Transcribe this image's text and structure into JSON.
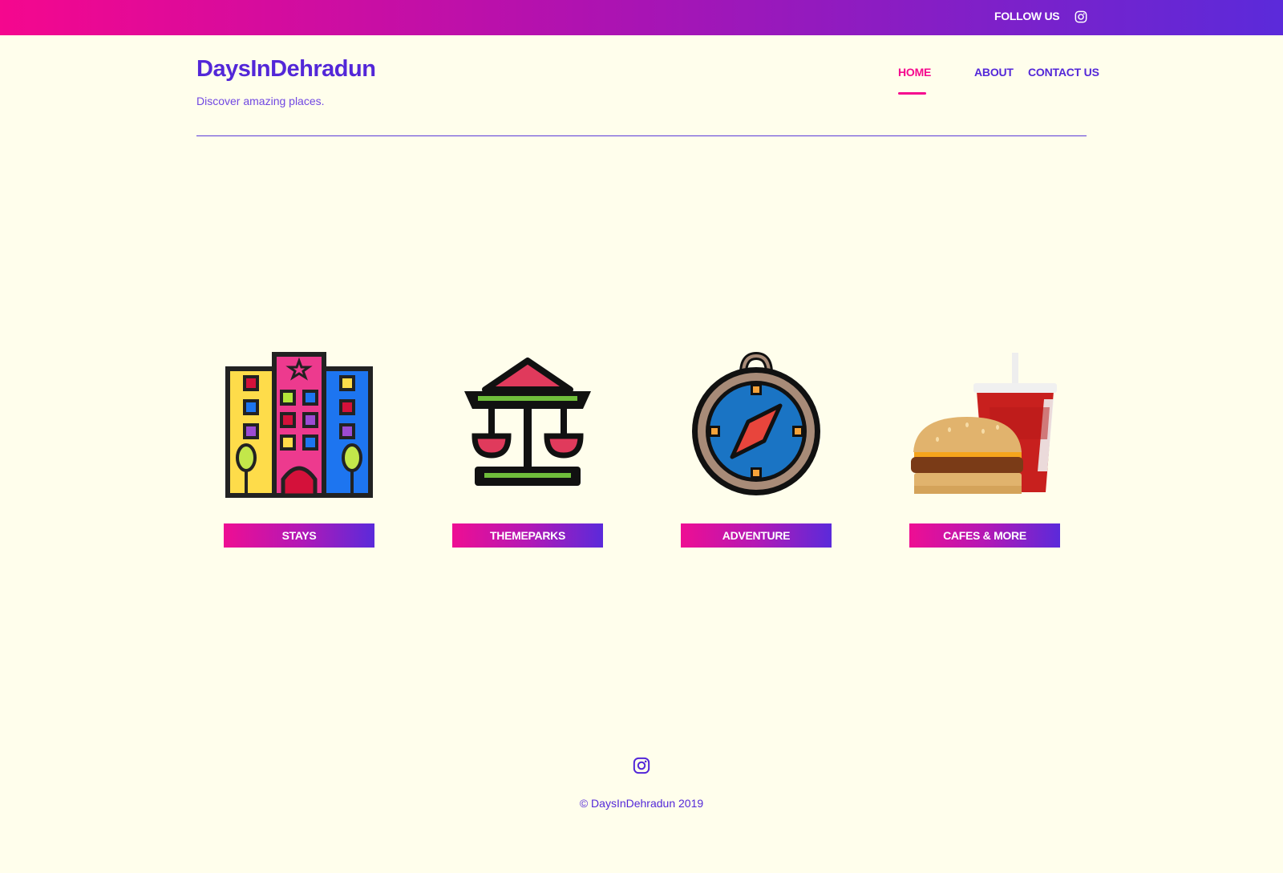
{
  "topbar": {
    "follow_label": "FOLLOW US",
    "social_icon": "instagram-icon"
  },
  "header": {
    "title": "DaysInDehradun",
    "subtitle": "Discover amazing places."
  },
  "nav": {
    "items": [
      {
        "label": "HOME",
        "active": true
      },
      {
        "label": "ABOUT",
        "active": false
      },
      {
        "label": "CONTACT US",
        "active": false
      }
    ]
  },
  "categories": [
    {
      "label": "STAYS",
      "icon": "hotel-building-icon"
    },
    {
      "label": "THEMEPARKS",
      "icon": "carousel-icon"
    },
    {
      "label": "ADVENTURE",
      "icon": "compass-icon"
    },
    {
      "label": "CAFES & MORE",
      "icon": "burger-drink-icon"
    }
  ],
  "footer": {
    "social_icon": "instagram-icon",
    "copyright": "© DaysInDehradun 2019"
  },
  "colors": {
    "background": "#fffeec",
    "accent_pink": "#f5078e",
    "accent_purple": "#5327d8"
  }
}
